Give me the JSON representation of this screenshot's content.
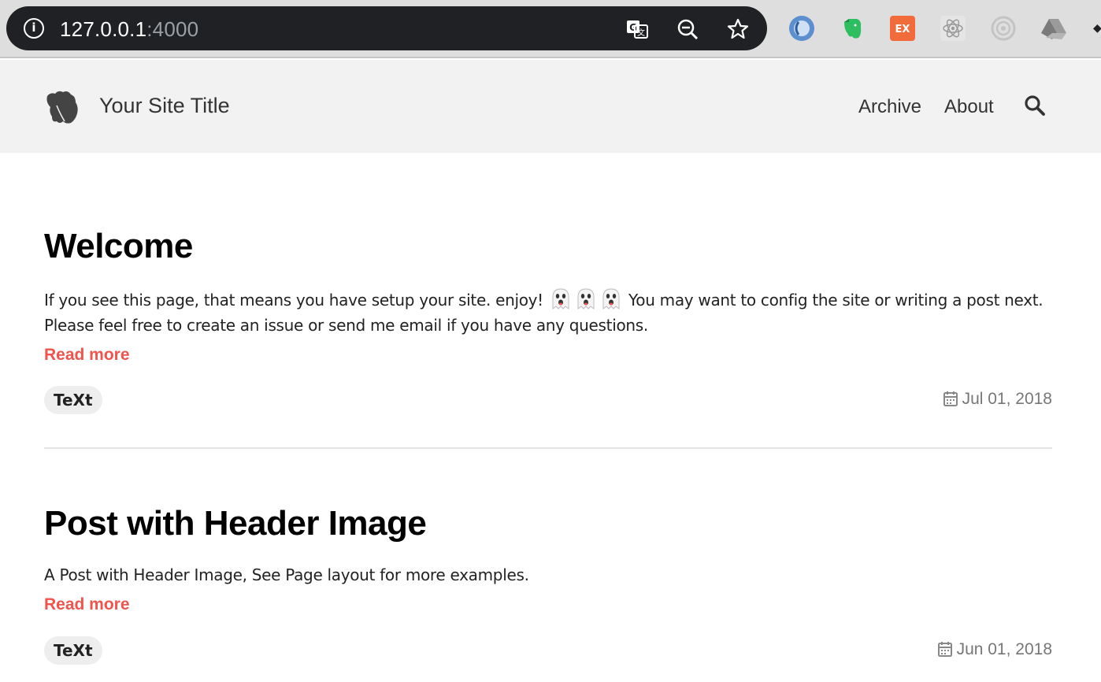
{
  "browser": {
    "url_host": "127.0.0.1",
    "url_port": ":4000",
    "icons": [
      "info-icon",
      "translate-icon",
      "zoom-out-icon",
      "star-icon"
    ],
    "extensions": [
      "jsonview-icon",
      "evernote-icon",
      "ex-extension-icon",
      "react-devtools-icon",
      "target-icon",
      "google-drive-icon"
    ],
    "ex_label": "EX"
  },
  "header": {
    "title": "Your Site Title",
    "nav": [
      "Archive",
      "About"
    ]
  },
  "posts": [
    {
      "title": "Welcome",
      "excerpt_before": "If you see this page, that means you have setup your site. enjoy!",
      "excerpt_after": "You may want to config the site or writing a post next.",
      "excerpt_line2": "Please feel free to create an issue or send me email if you have any questions.",
      "read_more": "Read more",
      "tag": "TeXt",
      "date": "Jul 01, 2018"
    },
    {
      "title": "Post with Header Image",
      "excerpt": "A Post with Header Image, See Page layout for more examples.",
      "read_more": "Read more",
      "tag": "TeXt",
      "date": "Jun 01, 2018"
    }
  ],
  "colors": {
    "accent": "#f0544d",
    "header_bg": "#f2f2f2",
    "omnibox_bg": "#202124"
  }
}
